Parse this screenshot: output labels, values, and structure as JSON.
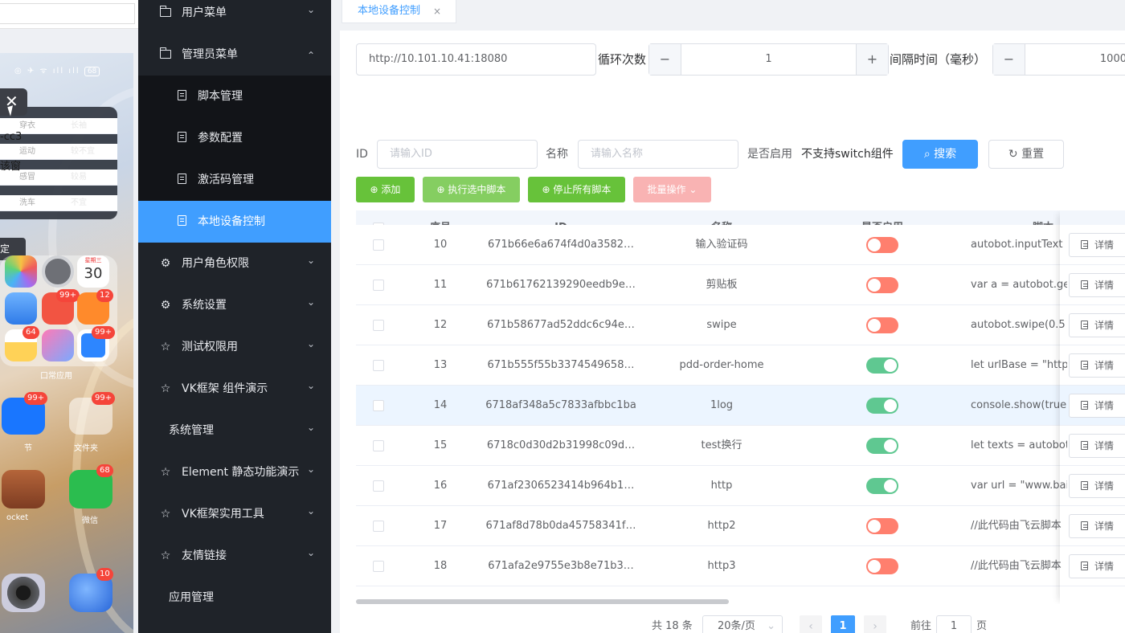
{
  "phone": {
    "widget_rows": [
      {
        "key": "穿衣",
        "value": "长袖"
      },
      {
        "key": "运动",
        "value": "较不宜"
      },
      {
        "key": "感冒",
        "value": "较易"
      },
      {
        "key": "洗车",
        "value": "不宜"
      }
    ],
    "label_cc3": "-cc3",
    "label_window": "该窗",
    "tip_text": "定",
    "calendar_weekday": "星期三",
    "calendar_day": "30",
    "badges": {
      "notes": "99+",
      "red_app": "99+",
      "heart_app": "12",
      "pen_app": "64",
      "browser_app": "99+",
      "u_app": "99+",
      "file_folder": "99+",
      "wechat": "68",
      "globe": "10"
    },
    "app_labels": {
      "common": "口常应用",
      "u_app": "节",
      "file_folder": "文件夹",
      "pocket": "ocket",
      "wechat": "微信"
    }
  },
  "sidebar": {
    "items": [
      {
        "label": "用户菜单",
        "icon": "folder-icon",
        "chevron": "⌄"
      },
      {
        "label": "管理员菜单",
        "icon": "folder-icon",
        "chevron": "⌃"
      },
      {
        "label": "脚本管理",
        "icon": "document-icon"
      },
      {
        "label": "参数配置",
        "icon": "document-icon"
      },
      {
        "label": "激活码管理",
        "icon": "document-icon"
      },
      {
        "label": "本地设备控制",
        "icon": "document-icon"
      },
      {
        "label": "用户角色权限",
        "icon": "gear-icon",
        "chevron": "⌄"
      },
      {
        "label": "系统设置",
        "icon": "gear-icon",
        "chevron": "⌄"
      },
      {
        "label": "测试权限用",
        "icon": "star-icon",
        "chevron": "⌄"
      },
      {
        "label": "VK框架 组件演示",
        "icon": "star-icon",
        "chevron": "⌄"
      },
      {
        "label": "系统管理",
        "chevron": "⌄"
      },
      {
        "label": "Element 静态功能演示",
        "icon": "star-icon",
        "chevron": "⌄"
      },
      {
        "label": "VK框架实用工具",
        "icon": "star-icon",
        "chevron": "⌄"
      },
      {
        "label": "友情链接",
        "icon": "star-icon",
        "chevron": "⌄"
      },
      {
        "label": "应用管理"
      }
    ]
  },
  "tab": {
    "label": "本地设备控制",
    "close": "×"
  },
  "device": {
    "url": "http://10.101.10.41:18080",
    "loop_label": "循环次数",
    "loop_value": "1",
    "interval_label": "间隔时间（毫秒）",
    "interval_value": "1000"
  },
  "search": {
    "id_label": "ID",
    "id_placeholder": "请输入ID",
    "name_label": "名称",
    "name_placeholder": "请输入名称",
    "enabled_label": "是否启用",
    "enabled_value": "不支持switch组件",
    "search_button": "搜索",
    "reset_button": "重置"
  },
  "toolbar": {
    "add": "添加",
    "run_selected": "执行选中脚本",
    "stop_all": "停止所有脚本",
    "batch": "批量操作"
  },
  "table": {
    "headers": {
      "index": "序号",
      "id": "ID",
      "name": "名称",
      "enabled": "是否启用",
      "script": "脚本"
    },
    "detail_label": "详情",
    "rows": [
      {
        "index": "10",
        "id": "671b66e6a674f4d0a3582…",
        "name": "输入验证码",
        "enabled": false,
        "script": "autobot.inputText"
      },
      {
        "index": "11",
        "id": "671b61762139290eedb9e…",
        "name": "剪贴板",
        "enabled": false,
        "script": "var a = autobot.ge"
      },
      {
        "index": "12",
        "id": "671b58677ad52ddc6c94e…",
        "name": "swipe",
        "enabled": false,
        "script": "autobot.swipe(0.5"
      },
      {
        "index": "13",
        "id": "671b555f55b3374549658…",
        "name": "pdd-order-home",
        "enabled": true,
        "script": "let urlBase = \"https"
      },
      {
        "index": "14",
        "id": "6718af348a5c7833afbbc1ba",
        "name": "1log",
        "enabled": true,
        "script": "console.show(true"
      },
      {
        "index": "15",
        "id": "6718c0d30d2b31998c09d…",
        "name": "test换行",
        "enabled": true,
        "script": "let texts = autobot"
      },
      {
        "index": "16",
        "id": "671af2306523414b964b1…",
        "name": "http",
        "enabled": true,
        "script": "var url = \"www.bai"
      },
      {
        "index": "17",
        "id": "671af8d78b0da45758341f…",
        "name": "http2",
        "enabled": false,
        "script": "//此代码由飞云脚本"
      },
      {
        "index": "18",
        "id": "671afa2e9755e3b8e71b3…",
        "name": "http3",
        "enabled": false,
        "script": "//此代码由飞云脚本"
      }
    ]
  },
  "pagination": {
    "total": "共 18 条",
    "page_size": "20条/页",
    "current_page": "1",
    "goto_label": "前往",
    "goto_value": "1",
    "page_suffix": "页"
  },
  "colors": {
    "primary": "#409eff",
    "success": "#67c23a",
    "switch_on": "#5fc891",
    "switch_off": "#ff7f6e",
    "sidebar_bg": "#1f2329"
  }
}
